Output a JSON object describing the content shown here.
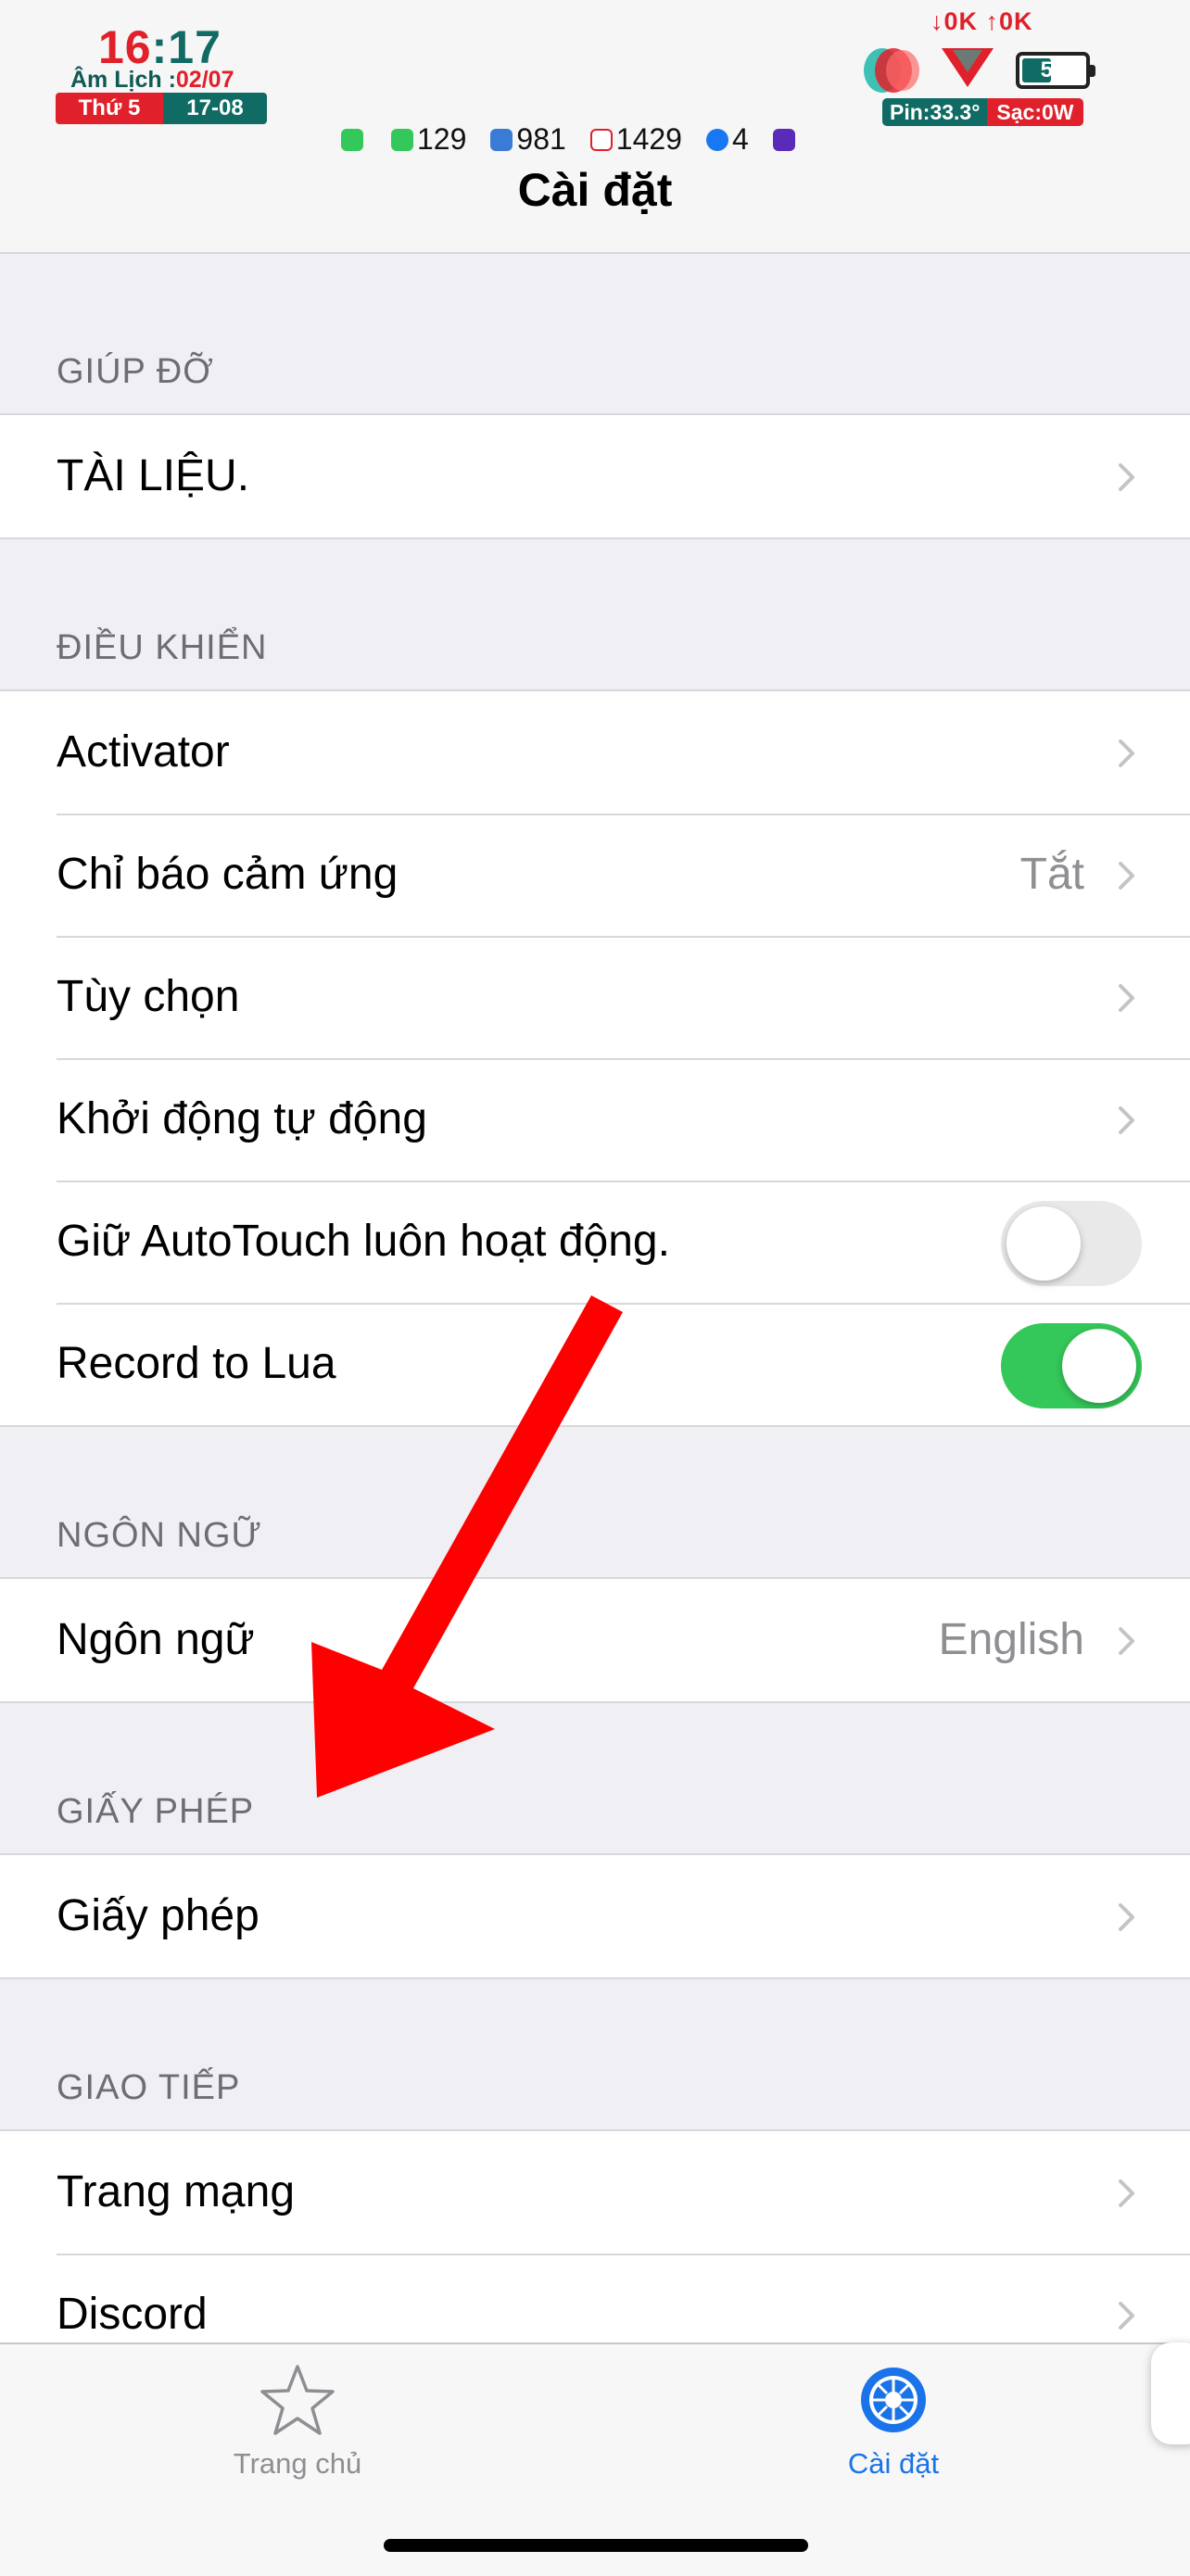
{
  "status": {
    "hour": "16",
    "minute": "17",
    "lunar_label": "Âm Lịch :",
    "lunar_date": "02/07",
    "weekday": "Thứ 5",
    "date": "17-08",
    "net_speed": "↓0K ↑0K",
    "battery_level": 51,
    "battery_text": "51",
    "pin_temp": "Pin:33.3°",
    "charge": "Sạc:0W",
    "badges": [
      {
        "icon": "phone-icon",
        "count": "",
        "color": "#34c759"
      },
      {
        "icon": "messages-icon",
        "count": "129",
        "color": "#34c759"
      },
      {
        "icon": "app-badge-icon",
        "count": "981",
        "color": "#3a7bd5"
      },
      {
        "icon": "gmail-icon",
        "count": "1429",
        "color": "#e0202a"
      },
      {
        "icon": "facebook-icon",
        "count": "4",
        "color": "#1877f2"
      },
      {
        "icon": "star-app-icon",
        "count": "",
        "color": "#5a2ab8"
      }
    ]
  },
  "nav": {
    "title": "Cài đặt"
  },
  "sections": {
    "help": {
      "header": "GIÚP ĐỠ",
      "rows": [
        "TÀI LIỆU."
      ]
    },
    "control": {
      "header": "ĐIỀU KHIỂN",
      "activator": "Activator",
      "touch_indicator": "Chỉ báo cảm ứng",
      "touch_indicator_value": "Tắt",
      "options": "Tùy chọn",
      "autostart": "Khởi động tự động",
      "keep_active": "Giữ AutoTouch luôn hoạt động.",
      "keep_active_on": false,
      "record_lua": "Record to Lua",
      "record_lua_on": true
    },
    "language": {
      "header": "NGÔN NGỮ",
      "label": "Ngôn ngữ",
      "value": "English"
    },
    "license": {
      "header": "GIẤY PHÉP",
      "label": "Giấy phép"
    },
    "communication": {
      "header": "GIAO TIẾP",
      "website": "Trang mạng",
      "discord": "Discord"
    }
  },
  "tabbar": {
    "home": "Trang chủ",
    "settings": "Cài đặt",
    "active": "settings",
    "active_color": "#1a73e8",
    "inactive_color": "#8e8e93"
  },
  "colors": {
    "toggle_on": "#34c759",
    "arrow_annotation": "#ff0000"
  }
}
